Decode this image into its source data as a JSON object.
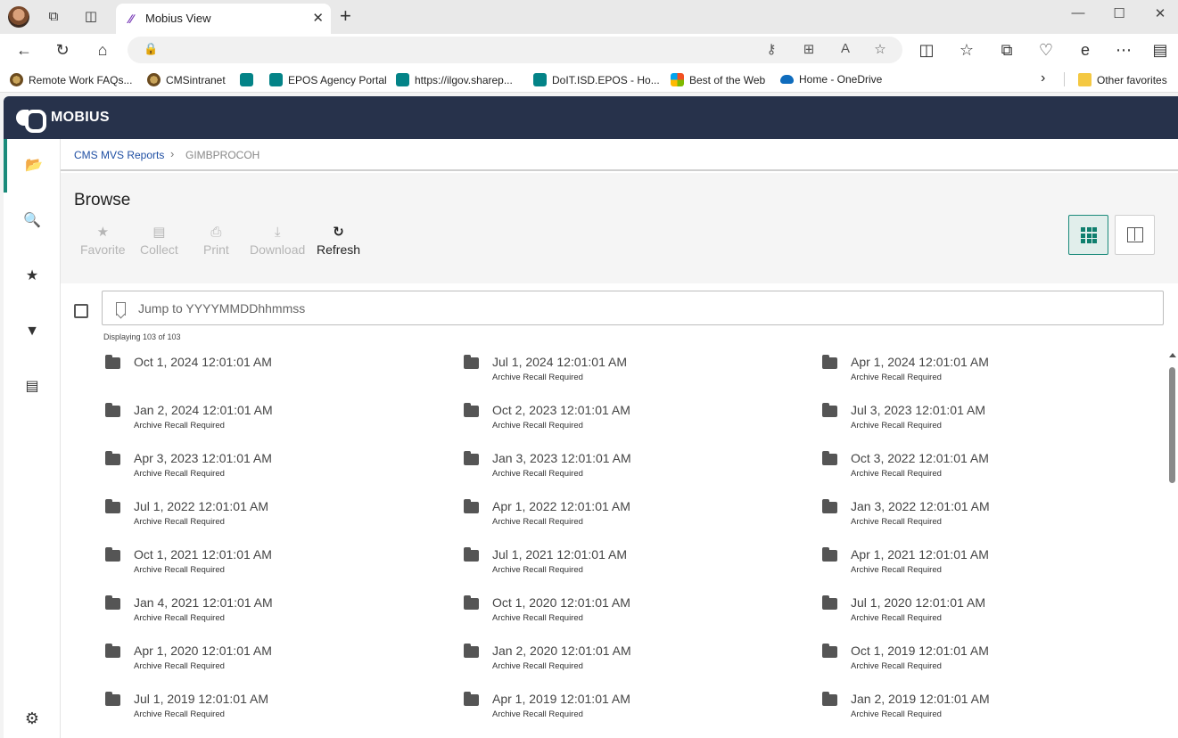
{
  "browser": {
    "tab_title": "Mobius View",
    "favorites": [
      {
        "label": "Remote Work FAQs...",
        "icon": "seal"
      },
      {
        "label": "CMSintranet",
        "icon": "seal"
      },
      {
        "label": "",
        "icon": "sp"
      },
      {
        "label": "EPOS Agency Portal",
        "icon": "sp"
      },
      {
        "label": "https://ilgov.sharep...",
        "icon": "sp"
      },
      {
        "label": "DoIT.ISD.EPOS - Ho...",
        "icon": "sp"
      },
      {
        "label": "Best of the Web",
        "icon": "ms"
      },
      {
        "label": "Home - OneDrive",
        "icon": "od"
      }
    ],
    "other_favorites": "Other favorites"
  },
  "app": {
    "brand": "MOBIUS",
    "breadcrumb": {
      "root": "CMS MVS Reports",
      "current": "GIMBPROCOH"
    },
    "page_title": "Browse",
    "toolbar": {
      "favorite": "Favorite",
      "collect": "Collect",
      "print": "Print",
      "download": "Download",
      "refresh": "Refresh"
    },
    "jump_placeholder": "Jump to YYYYMMDDhhmmss",
    "count_text": "Displaying 103 of 103",
    "items": [
      {
        "date": "Oct 1, 2024 12:01:01 AM",
        "sub": ""
      },
      {
        "date": "Jul 1, 2024 12:01:01 AM",
        "sub": "Archive Recall Required"
      },
      {
        "date": "Apr 1, 2024 12:01:01 AM",
        "sub": "Archive Recall Required"
      },
      {
        "date": "Jan 2, 2024 12:01:01 AM",
        "sub": "Archive Recall Required"
      },
      {
        "date": "Oct 2, 2023 12:01:01 AM",
        "sub": "Archive Recall Required"
      },
      {
        "date": "Jul 3, 2023 12:01:01 AM",
        "sub": "Archive Recall Required"
      },
      {
        "date": "Apr 3, 2023 12:01:01 AM",
        "sub": "Archive Recall Required"
      },
      {
        "date": "Jan 3, 2023 12:01:01 AM",
        "sub": "Archive Recall Required"
      },
      {
        "date": "Oct 3, 2022 12:01:01 AM",
        "sub": "Archive Recall Required"
      },
      {
        "date": "Jul 1, 2022 12:01:01 AM",
        "sub": "Archive Recall Required"
      },
      {
        "date": "Apr 1, 2022 12:01:01 AM",
        "sub": "Archive Recall Required"
      },
      {
        "date": "Jan 3, 2022 12:01:01 AM",
        "sub": "Archive Recall Required"
      },
      {
        "date": "Oct 1, 2021 12:01:01 AM",
        "sub": "Archive Recall Required"
      },
      {
        "date": "Jul 1, 2021 12:01:01 AM",
        "sub": "Archive Recall Required"
      },
      {
        "date": "Apr 1, 2021 12:01:01 AM",
        "sub": "Archive Recall Required"
      },
      {
        "date": "Jan 4, 2021 12:01:01 AM",
        "sub": "Archive Recall Required"
      },
      {
        "date": "Oct 1, 2020 12:01:01 AM",
        "sub": "Archive Recall Required"
      },
      {
        "date": "Jul 1, 2020 12:01:01 AM",
        "sub": "Archive Recall Required"
      },
      {
        "date": "Apr 1, 2020 12:01:01 AM",
        "sub": "Archive Recall Required"
      },
      {
        "date": "Jan 2, 2020 12:01:01 AM",
        "sub": "Archive Recall Required"
      },
      {
        "date": "Oct 1, 2019 12:01:01 AM",
        "sub": "Archive Recall Required"
      },
      {
        "date": "Jul 1, 2019 12:01:01 AM",
        "sub": "Archive Recall Required"
      },
      {
        "date": "Apr 1, 2019 12:01:01 AM",
        "sub": "Archive Recall Required"
      },
      {
        "date": "Jan 2, 2019 12:01:01 AM",
        "sub": "Archive Recall Required"
      }
    ],
    "colors": {
      "header": "#27324b",
      "accent": "#1a8a7a",
      "link": "#1f4fa3"
    }
  }
}
